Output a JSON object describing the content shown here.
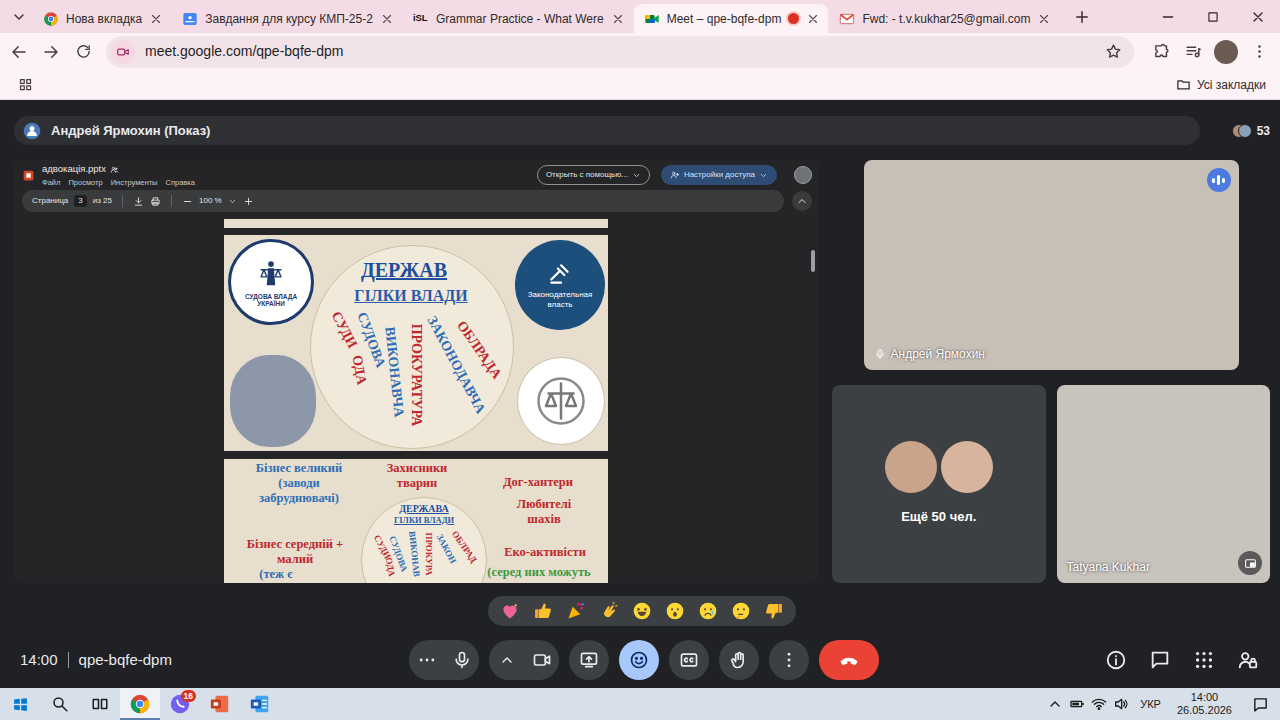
{
  "browser": {
    "tabs": [
      {
        "label": "Нова вкладка",
        "kind": "chrome",
        "selected": false,
        "recording": false
      },
      {
        "label": "Завдання для курсу КМП-25-2",
        "kind": "classroom",
        "selected": false,
        "recording": false
      },
      {
        "label": "Grammar Practice - What Were",
        "kind": "text",
        "favicon_text": "iSL",
        "selected": false,
        "recording": false
      },
      {
        "label": "Meet – qpe-bqfe-dpm",
        "kind": "meet",
        "selected": true,
        "recording": true
      },
      {
        "label": "Fwd: - t.v.kukhar25@gmail.com",
        "kind": "gmail",
        "selected": false,
        "recording": false
      }
    ],
    "address": "meet.google.com/qpe-bqfe-dpm",
    "bookmarked": false,
    "all_bookmarks": "Усі закладки"
  },
  "meet": {
    "presenter_bar": "Андрей Ярмохин (Показ)",
    "participant_count": "53",
    "viewer": {
      "file_name": "адвокація.pptx",
      "menu": [
        "Файл",
        "Просмотр",
        "Инструменты",
        "Справка"
      ],
      "open_with": "Открыть с помощью...",
      "share": "Настройки доступа",
      "page_label": "Страница",
      "page": "3",
      "page_of": "из 25",
      "zoom": "100 %"
    },
    "current_slide": {
      "title": "ДЕРЖАВ",
      "subtitle": "ГІЛКИ ВЛАДИ",
      "judiciary_logo": "СУДОВА ВЛАДА УКРАЇНИ",
      "legislature_badge": "Законодательная власть",
      "spokes": [
        {
          "text": "СУДИ",
          "color": "#c0272d"
        },
        {
          "text": "СУДОВА",
          "color": "#2f6eb5"
        },
        {
          "text": "ОДА",
          "color": "#c0272d"
        },
        {
          "text": "ВИКОНАВЧА",
          "color": "#2f6eb5"
        },
        {
          "text": "ПРОКУРАТУРА",
          "color": "#c0272d"
        },
        {
          "text": "ЗАКОНОДАВЧА",
          "color": "#2f6eb5"
        },
        {
          "text": "ОБЛРАДА",
          "color": "#c0272d"
        }
      ]
    },
    "next_slide": {
      "title": "ДЕРЖАВА",
      "subtitle": "ГІЛКИ ВЛАДИ",
      "spokes": [
        {
          "text": "СУДИ",
          "color": "#c0272d"
        },
        {
          "text": "СУДОВА",
          "color": "#2f6eb5"
        },
        {
          "text": "ОДА",
          "color": "#c0272d"
        },
        {
          "text": "ВИКОНАВ",
          "color": "#2f6eb5"
        },
        {
          "text": "ПРОКУРА",
          "color": "#c0272d"
        },
        {
          "text": "ЗАКОН",
          "color": "#2f6eb5"
        },
        {
          "text": "ОБЛРАД",
          "color": "#c0272d"
        }
      ],
      "groups": [
        {
          "lines": [
            "Бізнес великий",
            "(заводи",
            "забруднювачі)"
          ],
          "color": "#2f6eb5"
        },
        {
          "lines": [
            "Захисники",
            "тварин"
          ],
          "color": "#c0272d"
        },
        {
          "lines": [
            "Дог-хантери"
          ],
          "color": "#c0272d"
        },
        {
          "lines": [
            "Любителі",
            "шахів"
          ],
          "color": "#c0272d"
        },
        {
          "lines": [
            "Бізнес середній +",
            "малий"
          ],
          "color": "#c0272d"
        },
        {
          "lines": [
            "(теж є"
          ],
          "color": "#2f6eb5"
        },
        {
          "lines": [
            "Еко-активісти"
          ],
          "color": "#c0272d"
        },
        {
          "lines": [
            "(серед них можуть"
          ],
          "color": "#3d9a40"
        }
      ]
    },
    "tiles": [
      {
        "kind": "video",
        "name": "Андрей Ярмохин",
        "speaking": true
      },
      {
        "kind": "more",
        "name": "Ещё 50 чел."
      },
      {
        "kind": "video",
        "name": "Tatyana Kukhar",
        "speaking": false
      }
    ],
    "reactions": [
      {
        "kind": "heart"
      },
      {
        "kind": "thumbs-up"
      },
      {
        "kind": "party"
      },
      {
        "kind": "clap"
      },
      {
        "kind": "laugh"
      },
      {
        "kind": "wow"
      },
      {
        "kind": "sad"
      },
      {
        "kind": "think"
      },
      {
        "kind": "thumbs-down"
      }
    ],
    "time": "14:00",
    "meeting_code": "qpe-bqfe-dpm",
    "controls": [
      {
        "kind": "more",
        "selected": false
      },
      {
        "kind": "mic",
        "selected": false
      },
      {
        "kind": "camera-options",
        "selected": false
      },
      {
        "kind": "camera",
        "selected": false
      },
      {
        "kind": "present",
        "selected": false
      },
      {
        "kind": "reactions",
        "selected": true
      },
      {
        "kind": "captions",
        "selected": false
      },
      {
        "kind": "hand",
        "selected": false
      },
      {
        "kind": "options",
        "selected": false
      },
      {
        "kind": "hangup",
        "selected": false
      }
    ],
    "side_controls": [
      {
        "kind": "info"
      },
      {
        "kind": "chat"
      },
      {
        "kind": "activities"
      },
      {
        "kind": "host"
      }
    ]
  },
  "taskbar": {
    "pinned": [
      {
        "kind": "chrome",
        "active": true
      },
      {
        "kind": "viber",
        "active": false,
        "badge": "16"
      },
      {
        "kind": "powerpoint",
        "active": false
      },
      {
        "kind": "word",
        "active": false
      }
    ],
    "language": "УКР",
    "time": "14:00",
    "date": "26.05.2026"
  }
}
